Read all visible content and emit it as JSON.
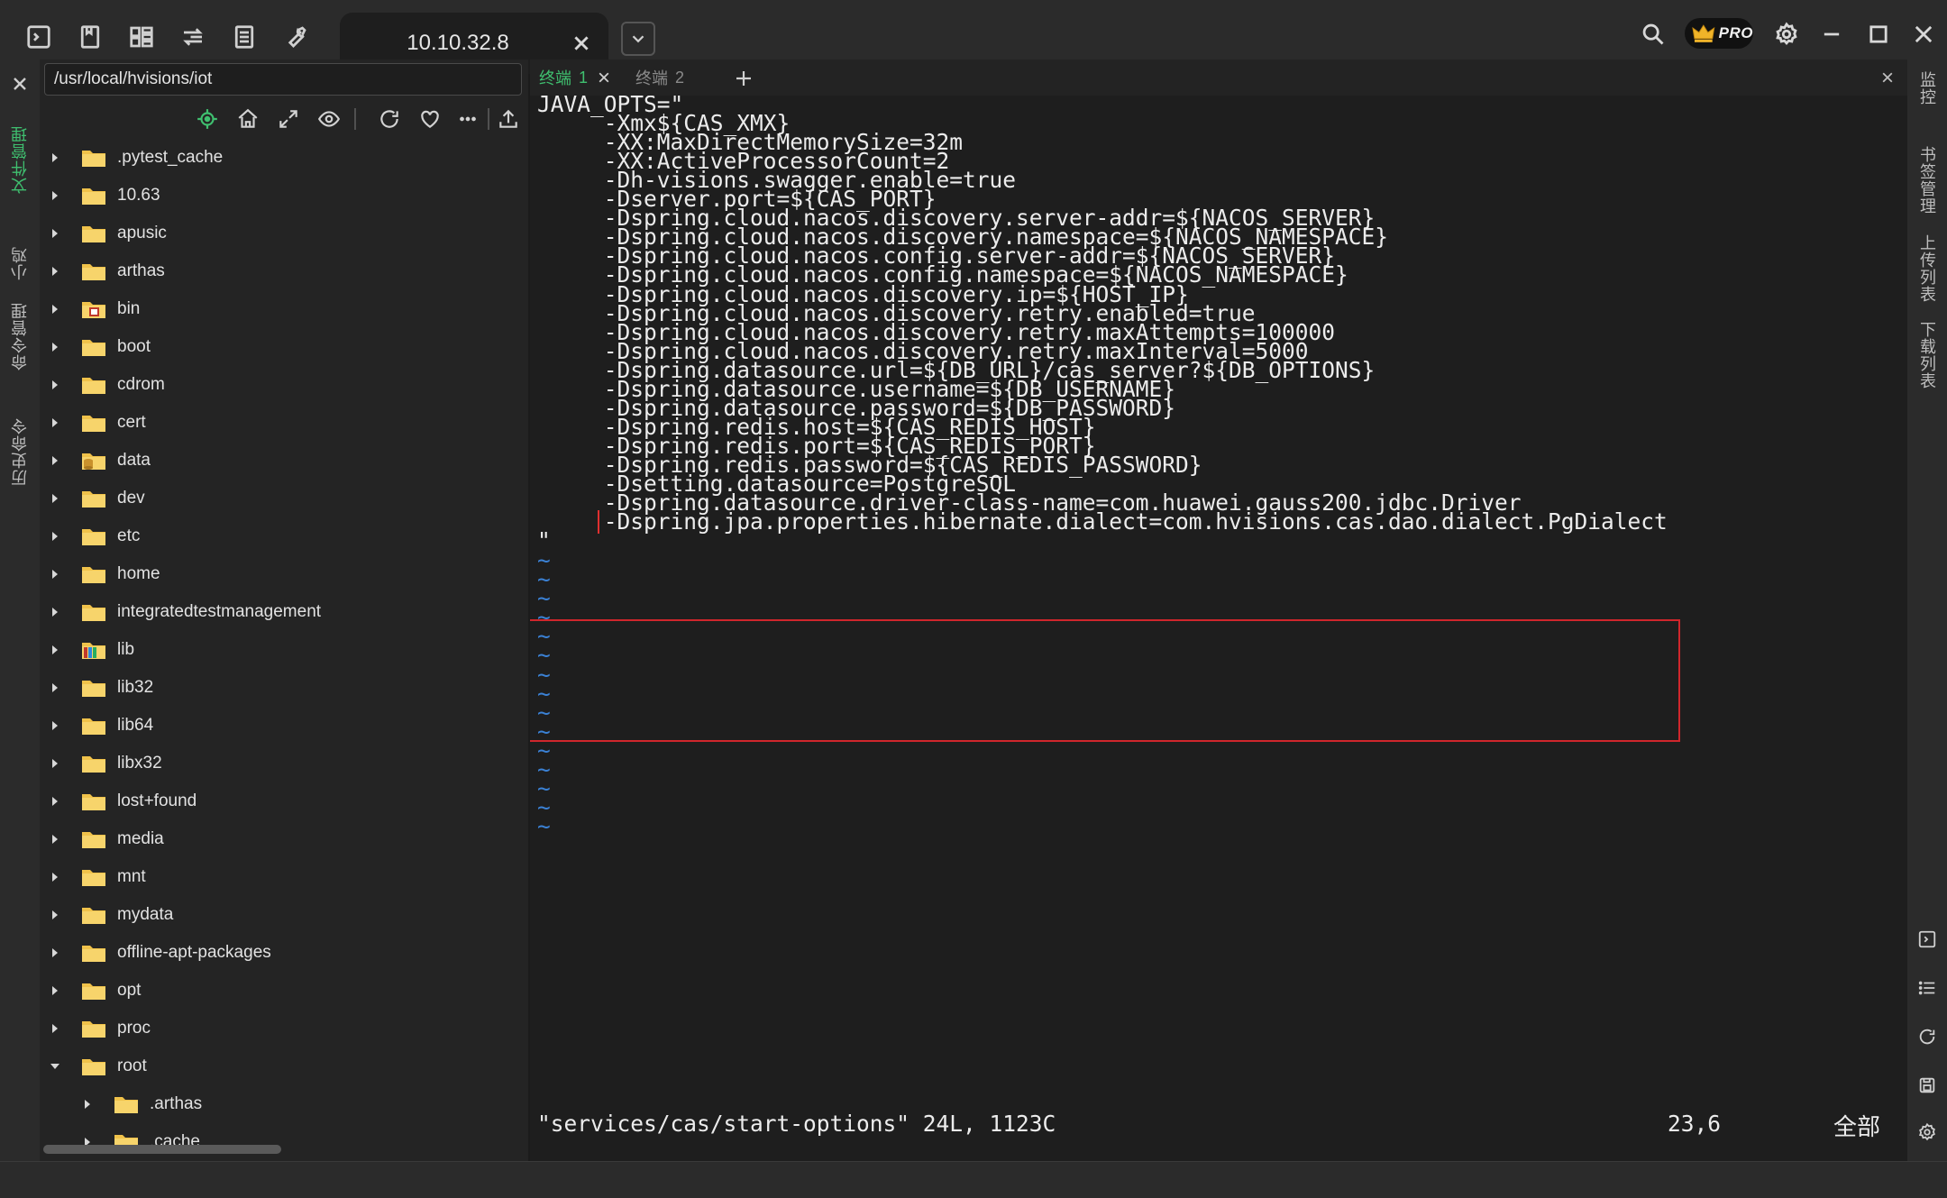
{
  "titlebar": {
    "tab_title": "10.10.32.8",
    "pro_label": "PRO"
  },
  "left_strip": {
    "tabs": [
      "文件管理",
      "小鸡",
      "命令管理",
      "历史命令"
    ]
  },
  "file_panel": {
    "path": "/usr/local/hvisions/iot",
    "tree": [
      {
        "name": ".pytest_cache",
        "icon": "folder-icon",
        "expanded": false,
        "depth": 0
      },
      {
        "name": "10.63",
        "icon": "folder-icon",
        "expanded": false,
        "depth": 0
      },
      {
        "name": "apusic",
        "icon": "folder-icon",
        "expanded": false,
        "depth": 0
      },
      {
        "name": "arthas",
        "icon": "folder-icon",
        "expanded": false,
        "depth": 0
      },
      {
        "name": "bin",
        "icon": "binary-folder-icon",
        "expanded": false,
        "depth": 0
      },
      {
        "name": "boot",
        "icon": "folder-icon",
        "expanded": false,
        "depth": 0
      },
      {
        "name": "cdrom",
        "icon": "folder-icon",
        "expanded": false,
        "depth": 0
      },
      {
        "name": "cert",
        "icon": "folder-icon",
        "expanded": false,
        "depth": 0
      },
      {
        "name": "data",
        "icon": "database-folder-icon",
        "expanded": false,
        "depth": 0
      },
      {
        "name": "dev",
        "icon": "folder-icon",
        "expanded": false,
        "depth": 0
      },
      {
        "name": "etc",
        "icon": "folder-icon",
        "expanded": false,
        "depth": 0
      },
      {
        "name": "home",
        "icon": "folder-icon",
        "expanded": false,
        "depth": 0
      },
      {
        "name": "integratedtestmanagement",
        "icon": "folder-icon",
        "expanded": false,
        "depth": 0
      },
      {
        "name": "lib",
        "icon": "library-folder-icon",
        "expanded": false,
        "depth": 0
      },
      {
        "name": "lib32",
        "icon": "folder-icon",
        "expanded": false,
        "depth": 0
      },
      {
        "name": "lib64",
        "icon": "folder-icon",
        "expanded": false,
        "depth": 0
      },
      {
        "name": "libx32",
        "icon": "folder-icon",
        "expanded": false,
        "depth": 0
      },
      {
        "name": "lost+found",
        "icon": "folder-icon",
        "expanded": false,
        "depth": 0
      },
      {
        "name": "media",
        "icon": "folder-icon",
        "expanded": false,
        "depth": 0
      },
      {
        "name": "mnt",
        "icon": "folder-icon",
        "expanded": false,
        "depth": 0
      },
      {
        "name": "mydata",
        "icon": "folder-icon",
        "expanded": false,
        "depth": 0
      },
      {
        "name": "offline-apt-packages",
        "icon": "folder-icon",
        "expanded": false,
        "depth": 0
      },
      {
        "name": "opt",
        "icon": "folder-icon",
        "expanded": false,
        "depth": 0
      },
      {
        "name": "proc",
        "icon": "folder-icon",
        "expanded": false,
        "depth": 0
      },
      {
        "name": "root",
        "icon": "folder-icon",
        "expanded": true,
        "depth": 0
      },
      {
        "name": ".arthas",
        "icon": "folder-icon",
        "expanded": false,
        "depth": 1
      },
      {
        "name": ".cache",
        "icon": "folder-icon",
        "expanded": false,
        "depth": 1
      }
    ]
  },
  "terminal": {
    "tabs": [
      {
        "name": "终端",
        "num": "1",
        "active": true
      },
      {
        "name": "终端",
        "num": "2",
        "active": false
      }
    ],
    "lines": [
      "JAVA_OPTS=\"",
      "     -Xmx${CAS_XMX}",
      "     -XX:MaxDirectMemorySize=32m",
      "     -XX:ActiveProcessorCount=2",
      "     -Dh-visions.swagger.enable=true",
      "     -Dserver.port=${CAS_PORT}",
      "     -Dspring.cloud.nacos.discovery.server-addr=${NACOS_SERVER}",
      "     -Dspring.cloud.nacos.discovery.namespace=${NACOS_NAMESPACE}",
      "     -Dspring.cloud.nacos.config.server-addr=${NACOS_SERVER}",
      "     -Dspring.cloud.nacos.config.namespace=${NACOS_NAMESPACE}",
      "     -Dspring.cloud.nacos.discovery.ip=${HOST_IP}",
      "     -Dspring.cloud.nacos.discovery.retry.enabled=true",
      "     -Dspring.cloud.nacos.discovery.retry.maxAttempts=100000",
      "     -Dspring.cloud.nacos.discovery.retry.maxInterval=5000",
      "     -Dspring.datasource.url=${DB_URL}/cas_server?${DB_OPTIONS}",
      "     -Dspring.datasource.username=${DB_USERNAME}",
      "     -Dspring.datasource.password=${DB_PASSWORD}",
      "     -Dspring.redis.host=${CAS_REDIS_HOST}",
      "     -Dspring.redis.port=${CAS_REDIS_PORT}",
      "     -Dspring.redis.password=${CAS_REDIS_PASSWORD}",
      "     -Dsetting.datasource=PostgreSQL",
      "     -Dspring.datasource.driver-class-name=com.huawei.gauss200.jdbc.Driver",
      "     -Dspring.jpa.properties.hibernate.dialect=com.hvisions.cas.dao.dialect.PgDialect",
      "\""
    ],
    "tilde_count": 15,
    "tilde": "~",
    "status_file": "\"services/cas/start-options\" 24L, 1123C",
    "status_pos": "23,6",
    "status_all": "全部"
  },
  "right_strip": {
    "tabs": [
      "监控",
      "书签管理",
      "上传列表",
      "下载列表"
    ]
  },
  "colors": {
    "accent_green": "#3fbf6f",
    "tilde_blue": "#3b82d6",
    "highlight_red": "#d0262c",
    "folder_yellow": "#f0c24a"
  }
}
